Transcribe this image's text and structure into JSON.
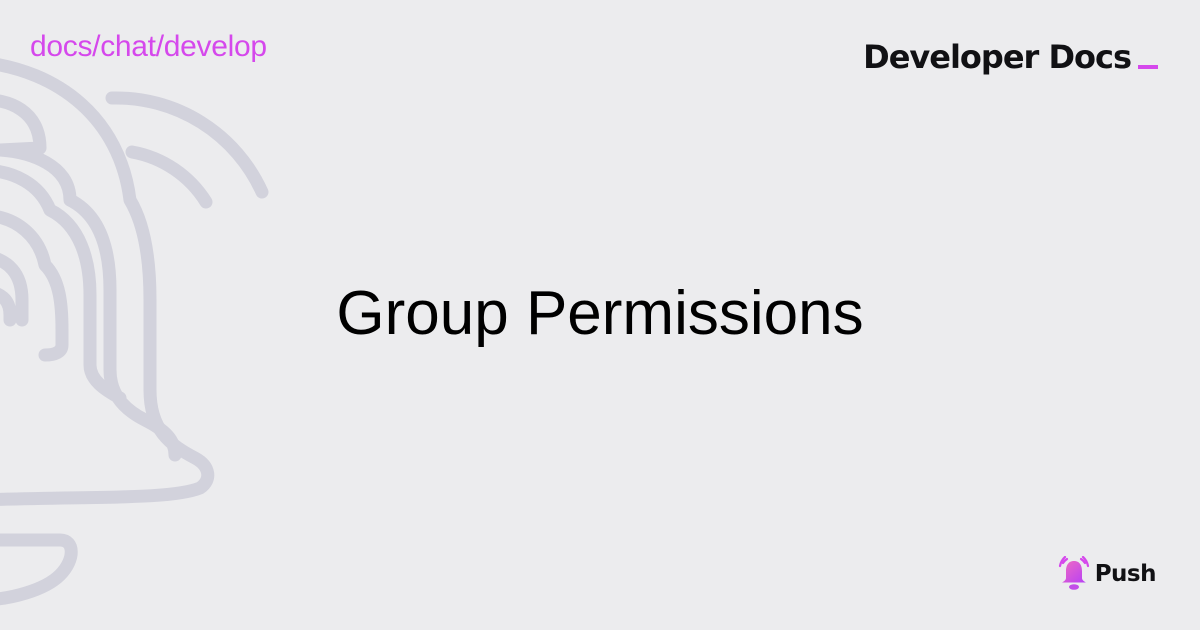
{
  "header": {
    "breadcrumb": "docs/chat/develop",
    "section_title": "Developer Docs"
  },
  "main": {
    "title": "Group Permissions"
  },
  "footer": {
    "logo_text": "Push"
  },
  "colors": {
    "background": "#ececee",
    "accent": "#d548ec",
    "text": "#111114",
    "decoration_stroke": "#d2d2dc"
  },
  "decoration": {
    "icon": "bell-icon"
  }
}
